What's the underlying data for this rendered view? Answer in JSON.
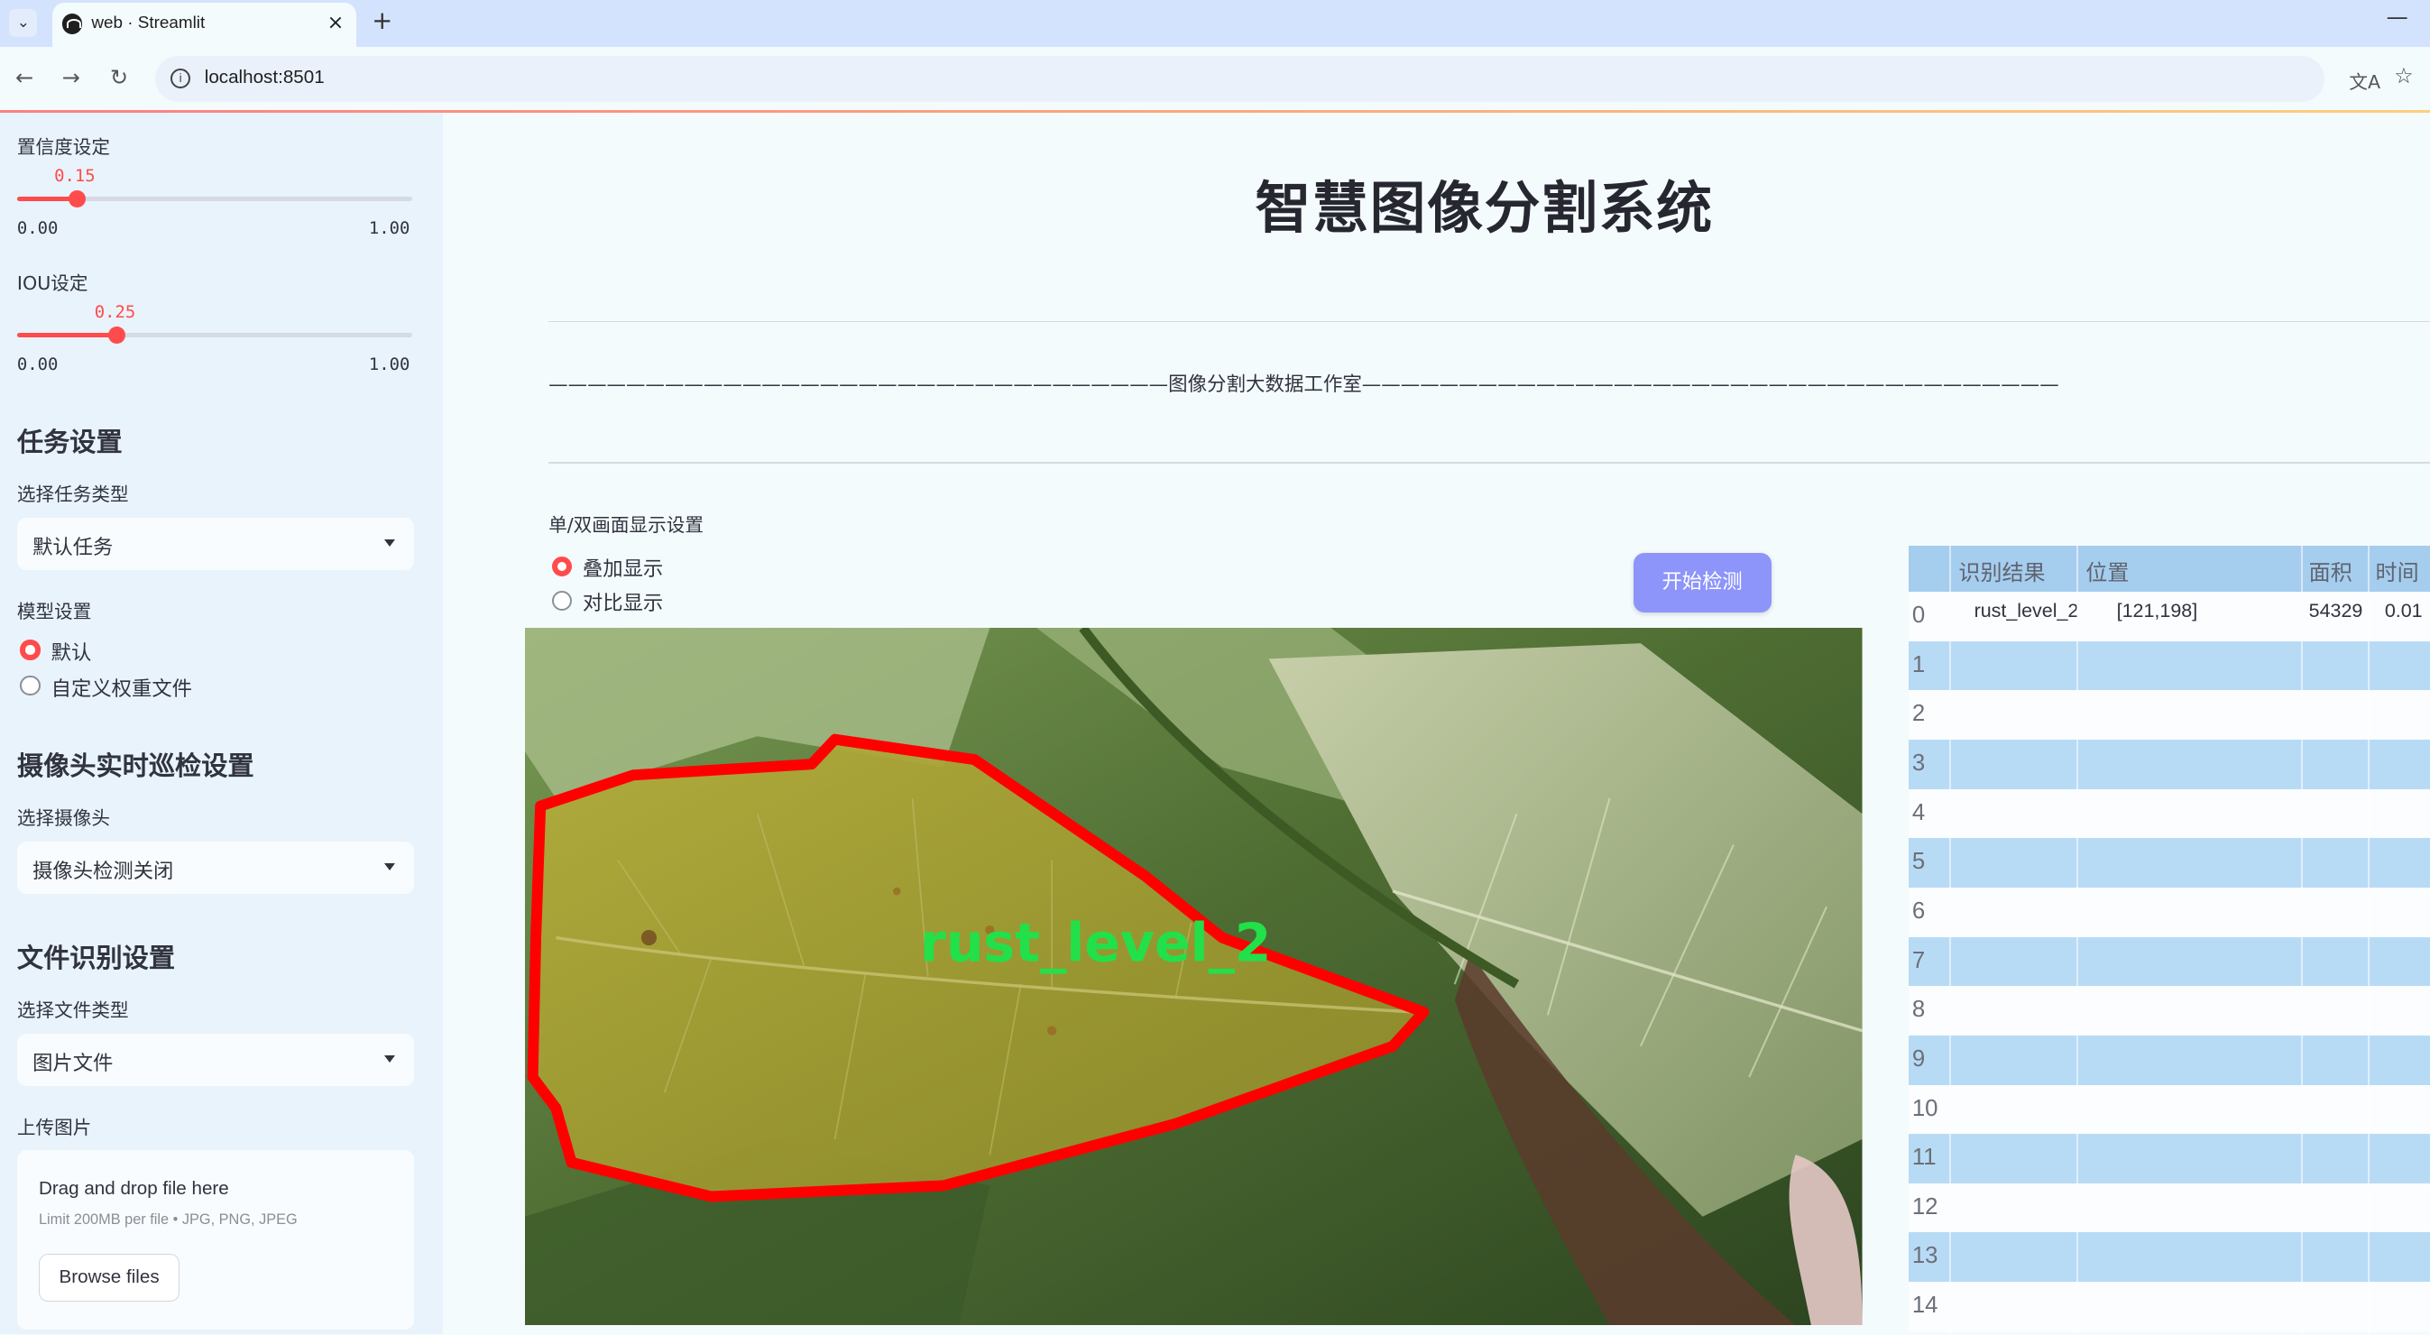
{
  "browser": {
    "tab_title": "web · Streamlit",
    "tab_close": "×",
    "new_tab": "+",
    "minimize": "—",
    "url": "localhost:8501",
    "info_glyph": "i"
  },
  "sidebar": {
    "confidence": {
      "label": "置信度设定",
      "value": "0.15",
      "fraction": 0.15,
      "min": "0.00",
      "max": "1.00"
    },
    "iou": {
      "label": "IOU设定",
      "value": "0.25",
      "fraction": 0.25,
      "min": "0.00",
      "max": "1.00"
    },
    "task_heading": "任务设置",
    "task_type_label": "选择任务类型",
    "task_type_value": "默认任务",
    "model_label": "模型设置",
    "model_options": [
      "默认",
      "自定义权重文件"
    ],
    "model_selected": "默认",
    "camera_heading": "摄像头实时巡检设置",
    "camera_label": "选择摄像头",
    "camera_value": "摄像头检测关闭",
    "file_heading": "文件识别设置",
    "file_type_label": "选择文件类型",
    "file_type_value": "图片文件",
    "upload_label": "上传图片",
    "upload_title": "Drag and drop file here",
    "upload_limit": "Limit 200MB per file • JPG, PNG, JPEG",
    "browse_button": "Browse files"
  },
  "main": {
    "title": "智慧图像分割系统",
    "studio_line": "————————————————————————————————图像分割大数据工作室————————————————————————————————————",
    "display_label": "单/双画面显示设置",
    "display_options": [
      "叠加显示",
      "对比显示"
    ],
    "display_selected": "叠加显示",
    "start_button": "开始检测",
    "detection_label": "rust_level_2"
  },
  "table": {
    "columns": [
      "识别结果",
      "位置",
      "面积",
      "时间"
    ],
    "rows": [
      {
        "index": "0",
        "result": "rust_level_2",
        "position": "[121,198]",
        "area": "54329",
        "time": "0.01"
      },
      {
        "index": "1"
      },
      {
        "index": "2"
      },
      {
        "index": "3"
      },
      {
        "index": "4"
      },
      {
        "index": "5"
      },
      {
        "index": "6"
      },
      {
        "index": "7"
      },
      {
        "index": "8"
      },
      {
        "index": "9"
      },
      {
        "index": "10"
      },
      {
        "index": "11"
      },
      {
        "index": "12"
      },
      {
        "index": "13"
      },
      {
        "index": "14"
      }
    ]
  },
  "colors": {
    "accent": "#ff4b4b",
    "button": "#8d95fa",
    "table_header": "#a5cdee",
    "table_stripe": "#b8dbf5",
    "mask_outline": "#ff0000",
    "label_text": "#22e04a"
  }
}
